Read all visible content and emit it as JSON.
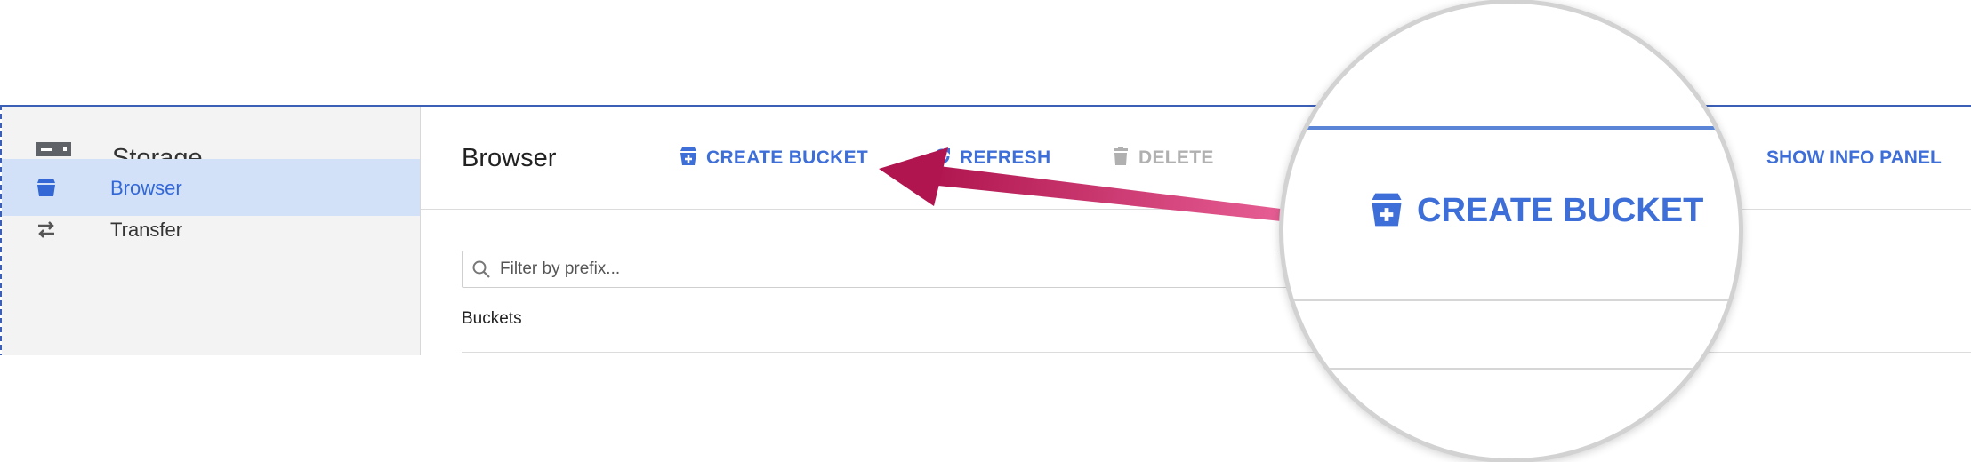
{
  "sidebar": {
    "title": "Storage",
    "items": [
      {
        "label": "Browser",
        "active": true
      },
      {
        "label": "Transfer",
        "active": false
      }
    ]
  },
  "main": {
    "title": "Browser",
    "toolbar": {
      "create_bucket": "CREATE BUCKET",
      "refresh": "REFRESH",
      "delete": "DELETE",
      "show_info_panel": "SHOW INFO PANEL"
    },
    "filter": {
      "placeholder": "Filter by prefix..."
    },
    "list_label": "Buckets"
  },
  "magnifier": {
    "label": "CREATE BUCKET"
  },
  "colors": {
    "accent": "#3e6fd8",
    "active_bg": "#d3e1f8",
    "disabled": "#b0b0b0",
    "arrow": "#b0154f",
    "arrow_tail": "#f06ba0"
  },
  "icons": {
    "storage": "storage-icon",
    "browser": "bucket-icon",
    "transfer": "transfer-icon",
    "create": "bucket-add-icon",
    "refresh": "refresh-icon",
    "delete": "trash-icon",
    "search": "search-icon"
  }
}
